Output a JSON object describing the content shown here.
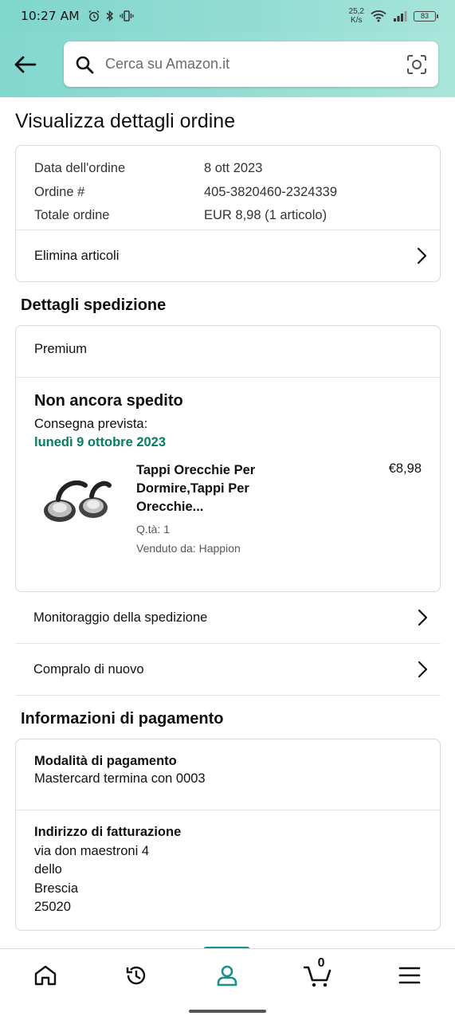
{
  "status_bar": {
    "time": "10:27 AM",
    "net_speed_value": "25,2",
    "net_speed_unit": "K/s",
    "battery": "83"
  },
  "header": {
    "search_placeholder": "Cerca su Amazon.it"
  },
  "page_title": "Visualizza dettagli ordine",
  "order_summary": {
    "rows": [
      {
        "label": "Data dell'ordine",
        "value": "8 ott 2023"
      },
      {
        "label": "Ordine #",
        "value": "405-3820460-2324339"
      },
      {
        "label": "Totale ordine",
        "value": "EUR 8,98 (1 articolo)"
      }
    ],
    "delete_items_label": "Elimina articoli"
  },
  "shipping": {
    "section_title": "Dettagli spedizione",
    "service": "Premium",
    "status": "Non ancora spedito",
    "delivery_label": "Consegna prevista:",
    "delivery_date": "lunedì 9 ottobre 2023",
    "product": {
      "name_line1": "Tappi Orecchie Per",
      "name_line2": "Dormire,Tappi Per",
      "name_line3": "Orecchie...",
      "quantity": "Q.tà: 1",
      "seller": "Venduto da: Happion",
      "price": "€8,98"
    },
    "track_label": "Monitoraggio della spedizione",
    "buy_again_label": "Compralo di nuovo"
  },
  "payment": {
    "section_title": "Informazioni di pagamento",
    "method_title": "Modalità di pagamento",
    "method_value": "Mastercard  termina con 0003",
    "billing_title": "Indirizzo di fatturazione",
    "address_lines": [
      "via don maestroni 4",
      "dello",
      "Brescia",
      "25020"
    ]
  },
  "bottom_nav": {
    "cart_count": "0",
    "active": "account"
  },
  "colors": {
    "header_teal": "#96ddd4",
    "delivery_green": "#067d62",
    "active_tab": "#1b8f8a"
  }
}
